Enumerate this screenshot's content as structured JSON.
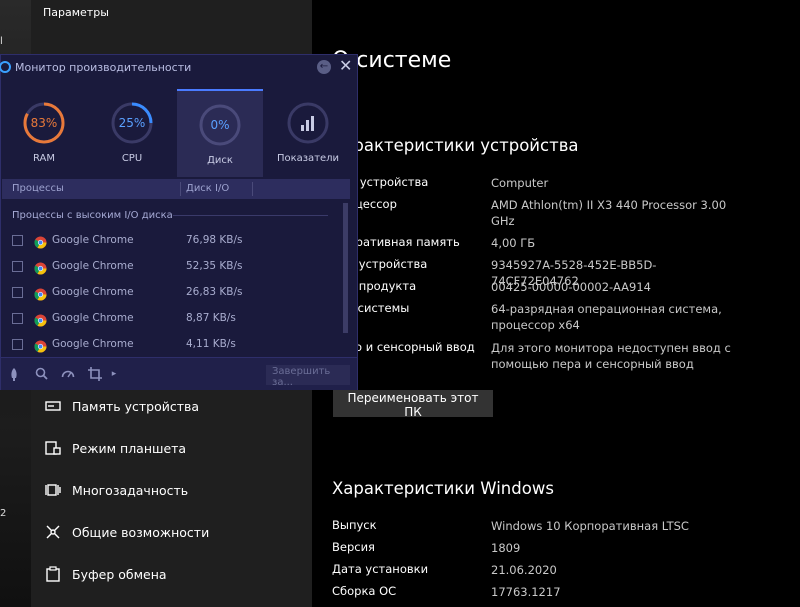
{
  "desktop": {
    "marks": [
      "l",
      "l",
      "l",
      "2"
    ]
  },
  "settings": {
    "title": "Параметры",
    "nav": [
      {
        "label": "Память устройства",
        "icon": "storage-icon"
      },
      {
        "label": "Режим планшета",
        "icon": "tablet-icon"
      },
      {
        "label": "Многозадачность",
        "icon": "multitasking-icon"
      },
      {
        "label": "Общие возможности",
        "icon": "share-icon"
      },
      {
        "label": "Буфер обмена",
        "icon": "clipboard-icon"
      }
    ]
  },
  "about": {
    "title": "О системе",
    "device_heading": "Характеристики устройства",
    "device": [
      {
        "label": "Имя устройства",
        "value": "Computer"
      },
      {
        "label": "Процессор",
        "value": "AMD Athlon(tm) II X3 440 Processor   3.00 GHz"
      },
      {
        "label": "Оперативная память",
        "value": "4,00 ГБ"
      },
      {
        "label": "Код устройства",
        "value": "9345927A-5528-452E-BB5D-74CF72E04762"
      },
      {
        "label": "Код продукта",
        "value": "00425-00000-00002-AA914"
      },
      {
        "label": "Тип системы",
        "value": "64-разрядная операционная система, процессор x64"
      },
      {
        "label": "Перо и сенсорный ввод",
        "value": "Для этого монитора недоступен ввод с помощью пера и сенсорный ввод"
      }
    ],
    "rename_button": "Переименовать этот ПК",
    "windows_heading": "Характеристики Windows",
    "windows": [
      {
        "label": "Выпуск",
        "value": "Windows 10 Корпоративная LTSC"
      },
      {
        "label": "Версия",
        "value": "1809"
      },
      {
        "label": "Дата установки",
        "value": "21.06.2020"
      },
      {
        "label": "Сборка ОС",
        "value": "17763.1217"
      }
    ]
  },
  "monitor": {
    "title": "Монитор производительности",
    "tabs": [
      {
        "label": "RAM",
        "value_text": "83%",
        "percent": 83,
        "color": "#e8793a"
      },
      {
        "label": "CPU",
        "value_text": "25%",
        "percent": 25,
        "color": "#3a8cff"
      },
      {
        "label": "Диск",
        "value_text": "0%",
        "percent": 0,
        "color": "#3a8cff"
      },
      {
        "label": "Показатели",
        "value_text": "",
        "percent": 0,
        "color": "#c8cbe4"
      }
    ],
    "columns": [
      "Процессы",
      "Диск I/O"
    ],
    "section_label": "Процессы с высоким I/O диска",
    "processes": [
      {
        "name": "Google Chrome",
        "value": "76,98 KB/s"
      },
      {
        "name": "Google Chrome",
        "value": "52,35 KB/s"
      },
      {
        "name": "Google Chrome",
        "value": "26,83 KB/s"
      },
      {
        "name": "Google Chrome",
        "value": "8,87 KB/s"
      },
      {
        "name": "Google Chrome",
        "value": "4,11 KB/s"
      }
    ],
    "end_button": "Завершить за..."
  }
}
